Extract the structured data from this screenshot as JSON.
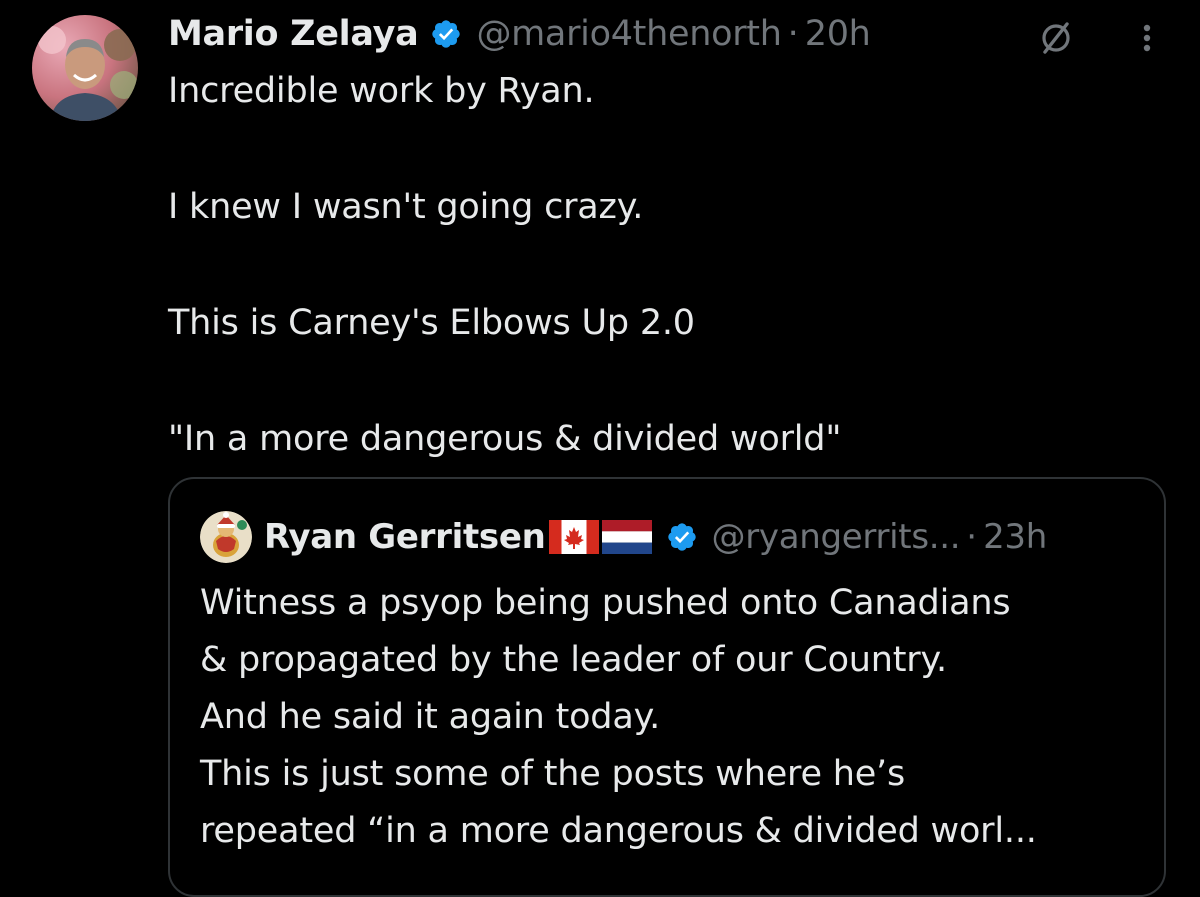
{
  "tweet": {
    "author_name": "Mario Zelaya",
    "handle": "@mario4thenorth",
    "separator": "·",
    "time": "20h",
    "verified_icon": "verified-badge-icon",
    "avatar_icon": "avatar",
    "lines": [
      "Incredible work by Ryan.",
      "",
      "I knew I wasn't going crazy.",
      "",
      "This is Carney's Elbows Up 2.0",
      "",
      "\"In a more dangerous & divided world\""
    ]
  },
  "actions": {
    "grok_icon": "grok-icon",
    "more_icon": "more-icon"
  },
  "quote": {
    "author_name": "Ryan Gerritsen",
    "handle": "@ryangerrits...",
    "separator": "·",
    "time": "23h",
    "flags": [
      "canada-flag-icon",
      "netherlands-flag-icon"
    ],
    "lines": [
      "Witness a psyop being pushed onto Canadians",
      "& propagated by the leader of our Country.",
      "And he said it again today.",
      "This is just some of the posts where he’s",
      "repeated “in a more dangerous & divided worl..."
    ]
  },
  "colors": {
    "background": "#000000",
    "primary_text": "#e7e9ea",
    "secondary_text": "#71767b",
    "verified_blue": "#1d9bf0",
    "border": "#2f3336"
  }
}
